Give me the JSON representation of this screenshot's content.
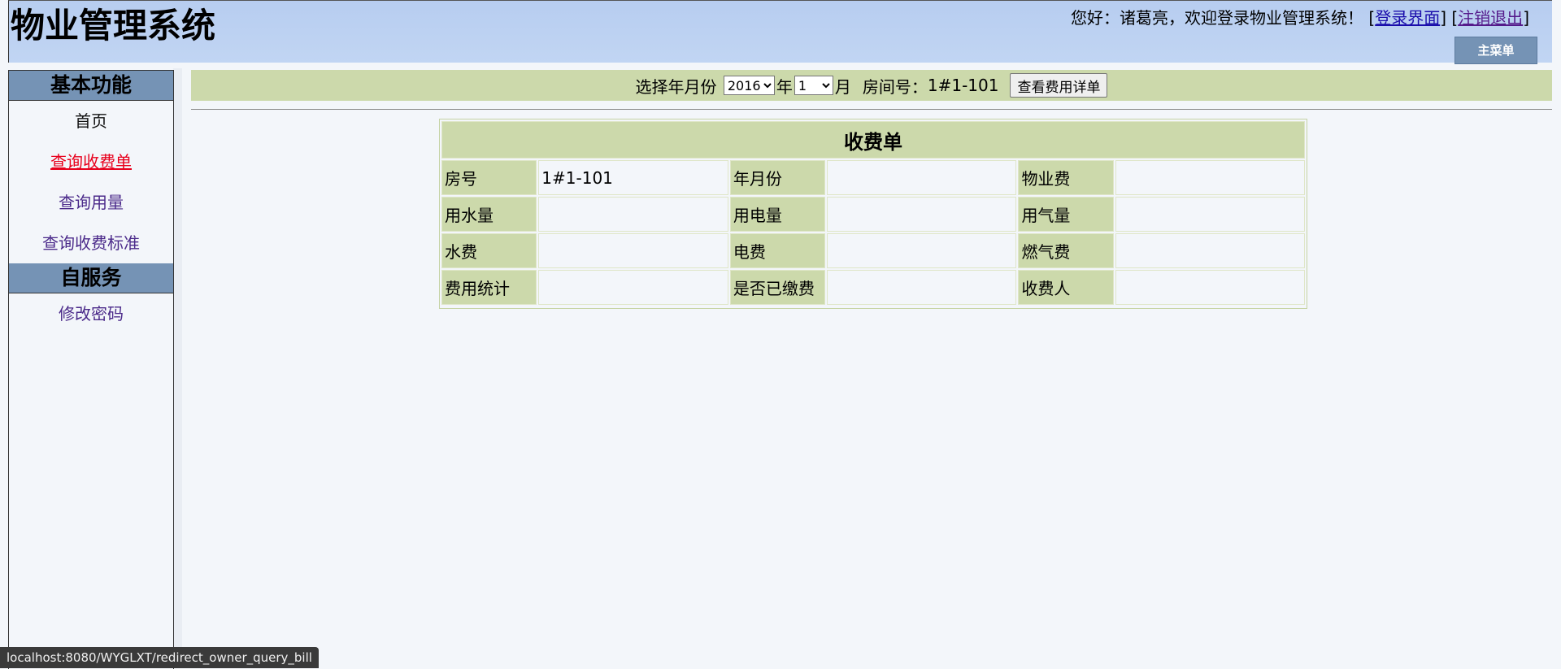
{
  "header": {
    "title": "物业管理系统",
    "greeting": "您好：诸葛亮，欢迎登录物业管理系统！",
    "login_link": "登录界面",
    "logout_link": "注销退出",
    "main_menu": "主菜单"
  },
  "sidebar": {
    "basic_heading": "基本功能",
    "items": [
      "首页",
      "查询收费单",
      "查询用量",
      "查询收费标准"
    ],
    "self_heading": "自服务",
    "self_items": [
      "修改密码"
    ]
  },
  "toolbar": {
    "select_label": "选择年月份",
    "year_value": "2016",
    "year_suffix": "年",
    "month_value": "1",
    "month_suffix": "月",
    "room_label": "房间号：",
    "room_value": "1#1-101",
    "detail_button": "查看费用详单"
  },
  "bill": {
    "title": "收费单",
    "rows": [
      [
        {
          "label": "房号",
          "value": "1#1-101"
        },
        {
          "label": "年月份",
          "value": ""
        },
        {
          "label": "物业费",
          "value": ""
        }
      ],
      [
        {
          "label": "用水量",
          "value": ""
        },
        {
          "label": "用电量",
          "value": ""
        },
        {
          "label": "用气量",
          "value": ""
        }
      ],
      [
        {
          "label": "水费",
          "value": ""
        },
        {
          "label": "电费",
          "value": ""
        },
        {
          "label": "燃气费",
          "value": ""
        }
      ],
      [
        {
          "label": "费用统计",
          "value": ""
        },
        {
          "label": "是否已缴费",
          "value": ""
        },
        {
          "label": "收费人",
          "value": ""
        }
      ]
    ]
  },
  "statusbar": {
    "url": "localhost:8080/WYGLXT/redirect_owner_query_bill"
  }
}
